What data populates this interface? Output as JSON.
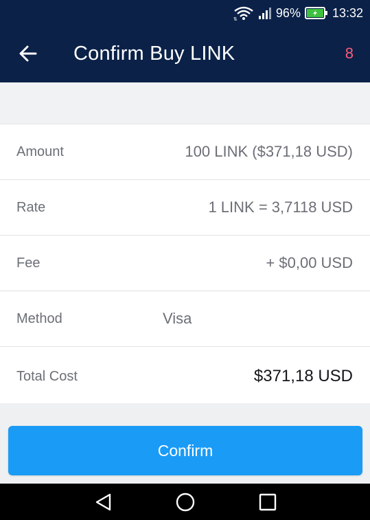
{
  "status_bar": {
    "battery_percent": "96%",
    "time": "13:32",
    "icons": [
      "wifi-icon",
      "signal-icon",
      "battery-charging-icon"
    ],
    "battery_color": "#3ec13e"
  },
  "header": {
    "title": "Confirm Buy LINK",
    "badge": "8",
    "badge_color": "#ff5a7a",
    "background": "#0b2148",
    "back_icon": "arrow-left-icon"
  },
  "details": [
    {
      "label": "Amount",
      "value": "100 LINK ($371,18 USD)"
    },
    {
      "label": "Rate",
      "value": "1 LINK = 3,7118 USD"
    },
    {
      "label": "Fee",
      "value": "+ $0,00 USD"
    },
    {
      "label": "Method",
      "value": "Visa"
    },
    {
      "label": "Total Cost",
      "value": "$371,18 USD"
    }
  ],
  "confirm_button": {
    "label": "Confirm",
    "color": "#1a9bf6"
  },
  "nav_bar": {
    "icons": [
      "back-triangle-icon",
      "home-circle-icon",
      "recents-square-icon"
    ]
  }
}
